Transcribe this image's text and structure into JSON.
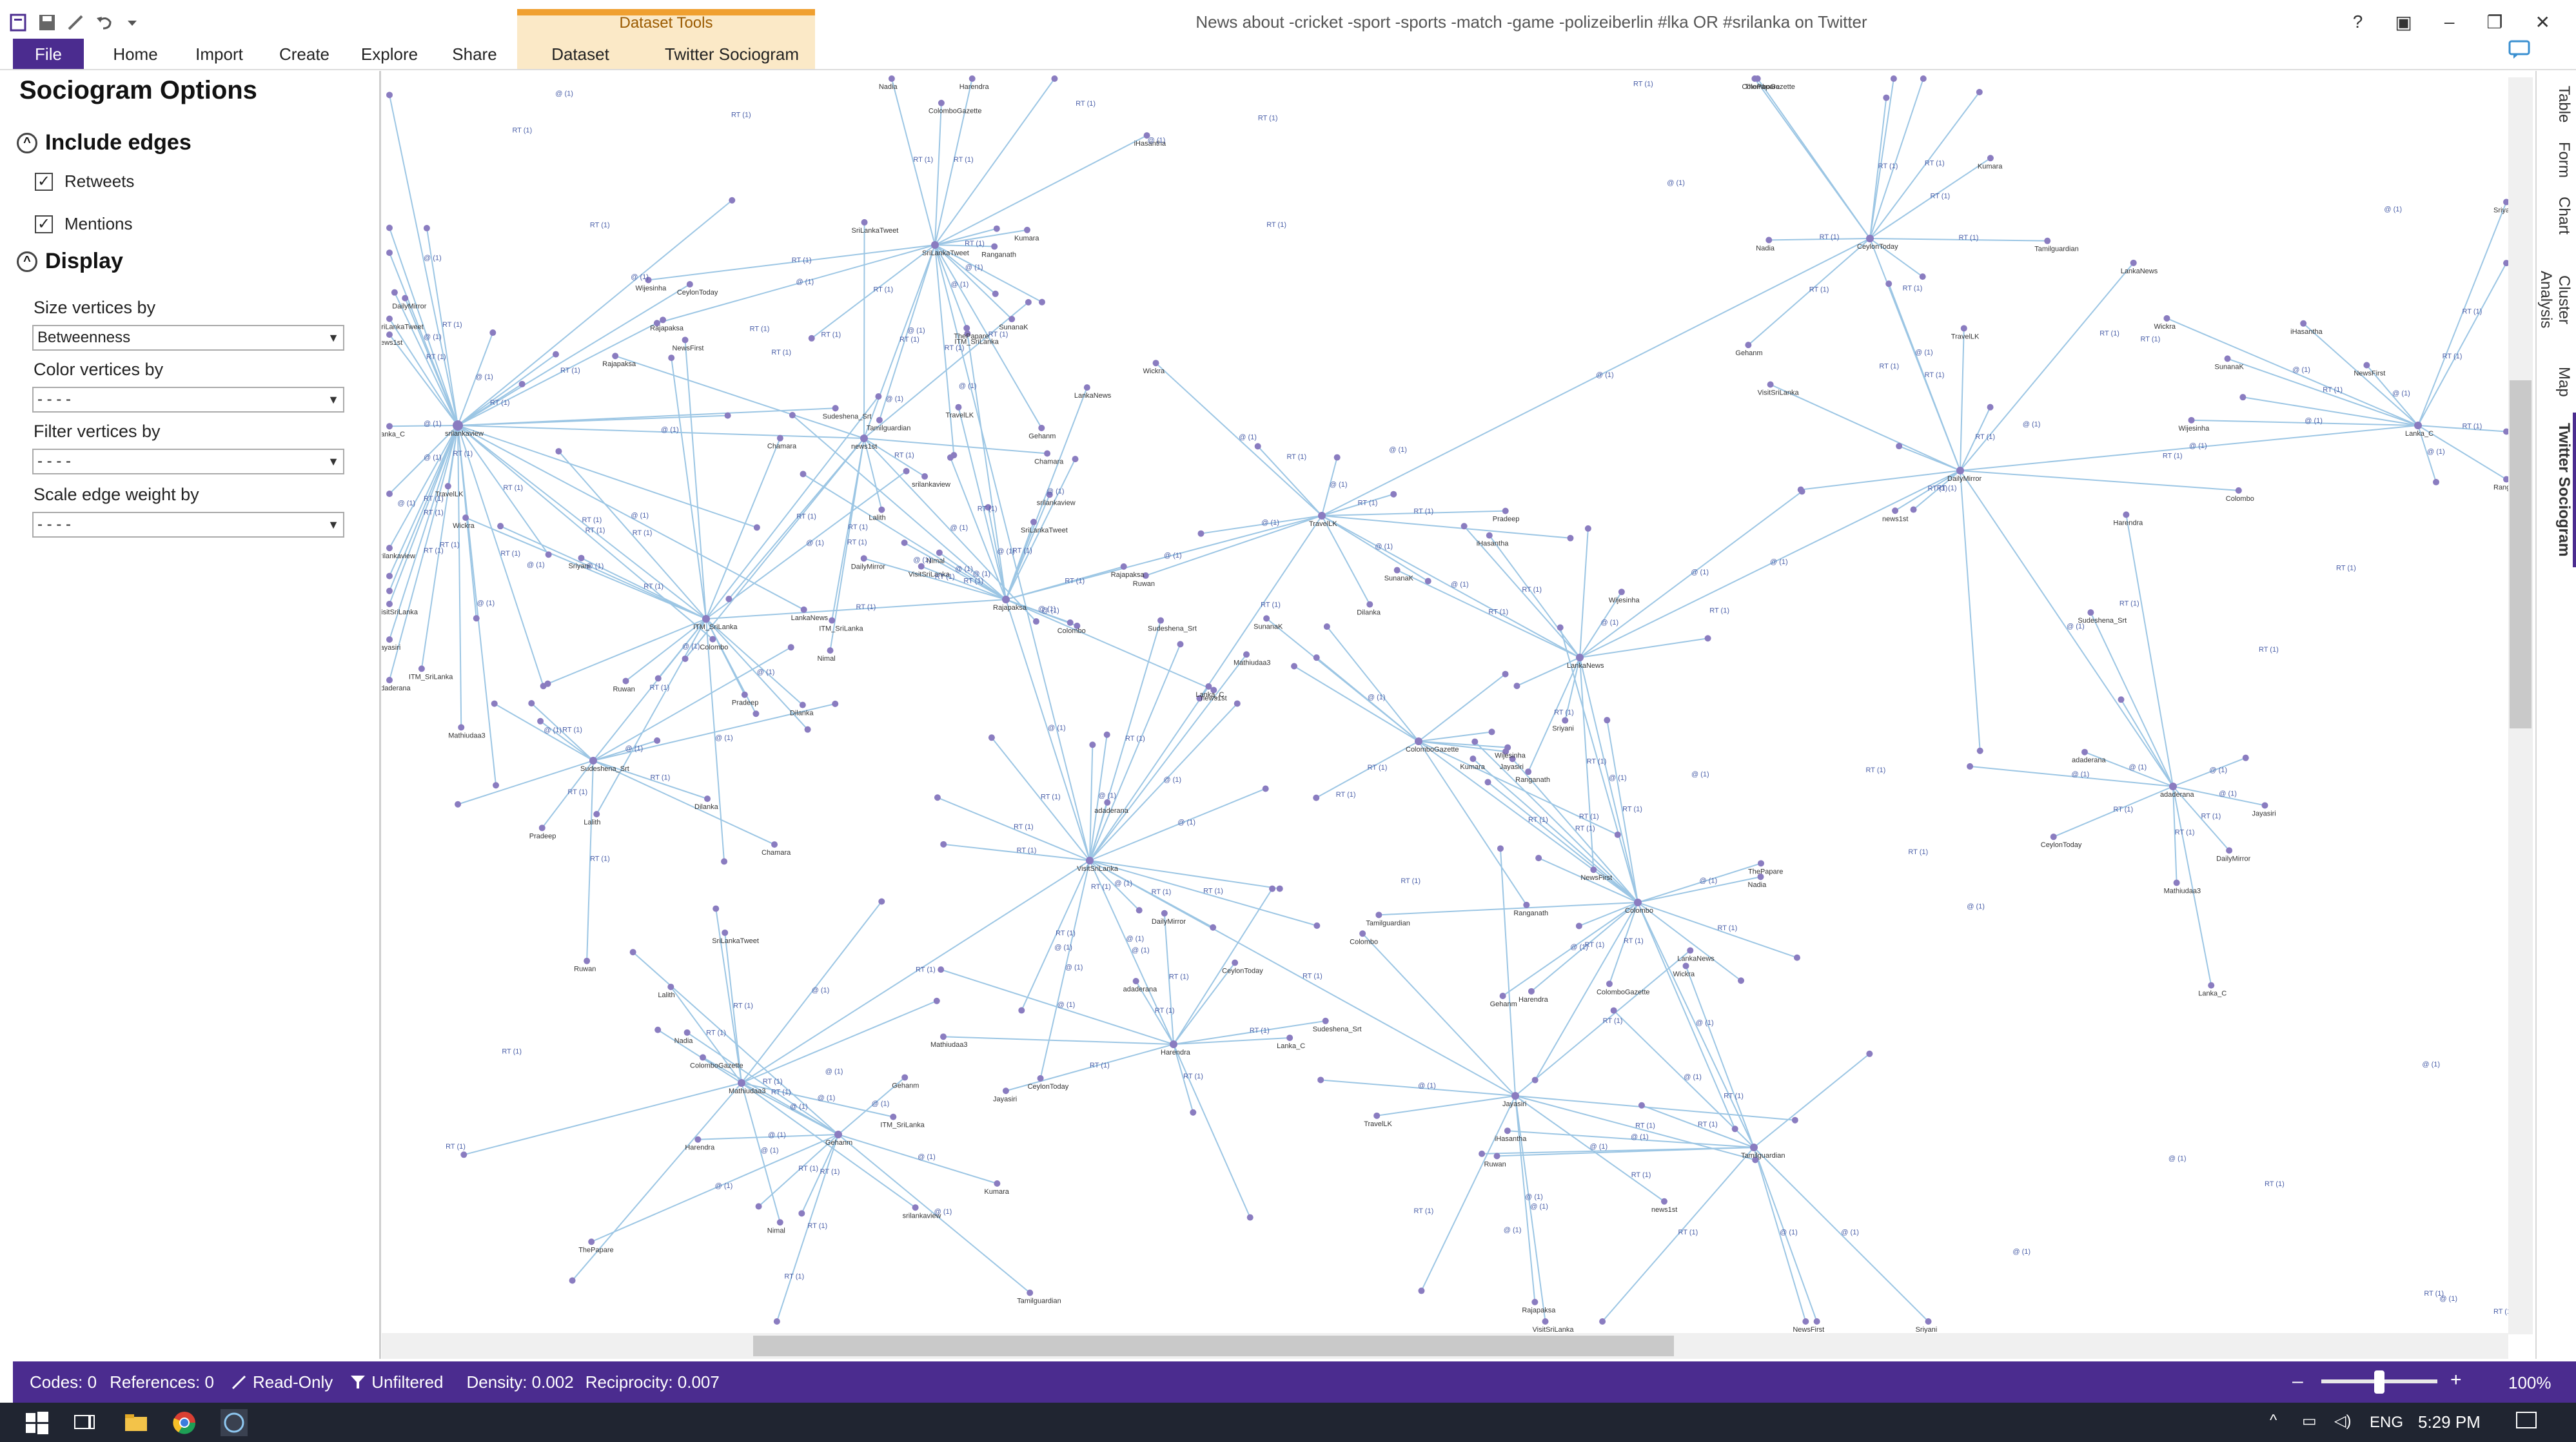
{
  "window": {
    "title": "News about -cricket -sport -sports -match -game -polizeiberlin #lka OR #srilanka on Twitter",
    "controls": [
      "?",
      "▣",
      "–",
      "❐",
      "✕"
    ]
  },
  "ribbon": {
    "tabs": [
      "File",
      "Home",
      "Import",
      "Create",
      "Explore",
      "Share"
    ],
    "context_group": "Dataset Tools",
    "context_tabs": [
      "Dataset",
      "Twitter Sociogram"
    ]
  },
  "panel": {
    "title": "Sociogram Options",
    "include_edges": {
      "heading": "Include edges",
      "retweets": {
        "label": "Retweets",
        "checked": true
      },
      "mentions": {
        "label": "Mentions",
        "checked": true
      }
    },
    "display": {
      "heading": "Display",
      "size_label": "Size vertices by",
      "size_value": "Betweenness",
      "color_label": "Color vertices by",
      "color_value": "- - - -",
      "filter_label": "Filter vertices by",
      "filter_value": "- - - -",
      "scale_label": "Scale edge weight by",
      "scale_value": "- - - -"
    }
  },
  "side_tabs": [
    "Table",
    "Form",
    "Chart",
    "Cluster Analysis",
    "Map",
    "Twitter Sociogram"
  ],
  "status": {
    "codes": "Codes: 0",
    "references": "References: 0",
    "readonly": "Read-Only",
    "unfiltered": "Unfiltered",
    "density": "Density: 0.002",
    "reciprocity": "Reciprocity: 0.007",
    "zoom": "100%",
    "zoom_level": 0.5
  },
  "taskbar": {
    "lang": "ENG",
    "time": "5:29 PM"
  },
  "graph": {
    "edge_label_rt": "RT (1)",
    "edge_label_at": "@ (1)",
    "colors": {
      "edge": "#9cc6e4",
      "node": "#8a7cc0",
      "label": "#333"
    },
    "node_labels": [
      "srilankaview",
      "SriLankaTweet",
      "ITM_SriLanka",
      "Rajapaksa",
      "VisitSriLanka",
      "Colombo",
      "LankaNews",
      "TravelLK",
      "news1st",
      "DailyMirror",
      "adaderana",
      "CeylonToday",
      "Lanka_C",
      "Sudeshena_Srt",
      "Mathiudaa3",
      "Jayasiri",
      "Harendra",
      "Gehanm",
      "ColomboGazette",
      "Tamilguardian",
      "Nadia",
      "ThePapare",
      "Kumara",
      "SunanaK",
      "Wijesinha",
      "Ranganath",
      "iHasantha",
      "Sriyani",
      "NewsFirst",
      "Wickra",
      "Ruwan",
      "Dilanka",
      "Pradeep",
      "Chamara",
      "Lalith",
      "Nimal"
    ]
  }
}
